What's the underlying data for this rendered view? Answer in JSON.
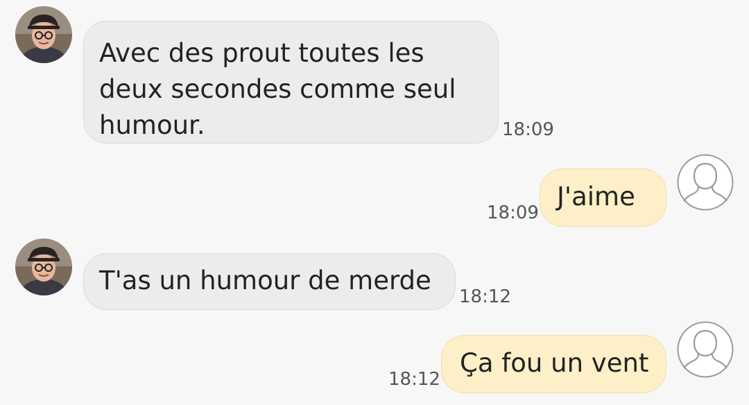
{
  "conversation": {
    "messages": [
      {
        "direction": "incoming",
        "avatar_icon": "contact-photo-avatar",
        "lines": [
          "Avec des prout toutes les",
          "deux secondes comme seul",
          "humour."
        ],
        "time": "18:09"
      },
      {
        "direction": "outgoing",
        "avatar_icon": "default-user-avatar-icon",
        "lines": [
          "J'aime"
        ],
        "time": "18:09"
      },
      {
        "direction": "incoming",
        "avatar_icon": "contact-photo-avatar",
        "lines": [
          "T'as un humour de merde"
        ],
        "time": "18:12"
      },
      {
        "direction": "outgoing",
        "avatar_icon": "default-user-avatar-icon",
        "lines": [
          "Ça fou un vent"
        ],
        "time": "18:12"
      }
    ]
  },
  "colors": {
    "background": "#f7f7f7",
    "incoming_bubble": "#ececec",
    "outgoing_bubble": "#fdf0c8",
    "text": "#222222",
    "timestamp": "#555555"
  }
}
